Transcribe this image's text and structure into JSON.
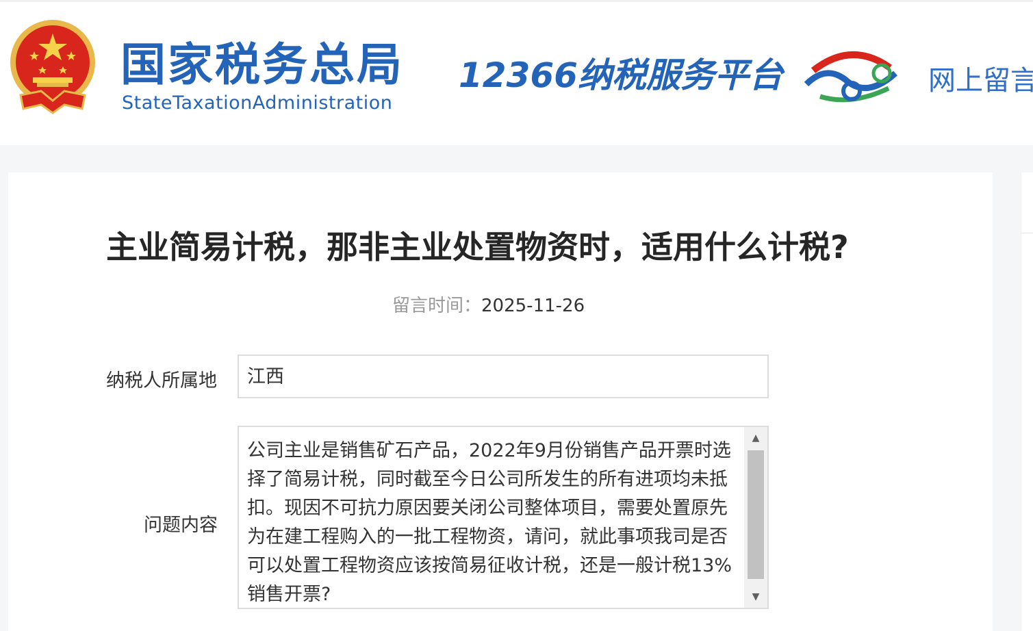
{
  "header": {
    "brand_cn": "国家税务总局",
    "brand_en": "StateTaxationAdministration",
    "platform_title": "12366纳税服务平台",
    "nav_link": "网上留言",
    "accent_color": "#2464b8"
  },
  "article": {
    "title": "主业简易计税，那非主业处置物资时，适用什么计税?",
    "meta_label": "留言时间：",
    "meta_date": "2025-11-26"
  },
  "form": {
    "region_label": "纳税人所属地",
    "region_value": "江西",
    "question_label": "问题内容",
    "question_value": "公司主业是销售矿石产品，2022年9月份销售产品开票时选择了简易计税，同时截至今日公司所发生的所有进项均未抵扣。现因不可抗力原因要关闭公司整体项目，需要处置原先为在建工程购入的一批工程物资，请问，就此事项我司是否可以处置工程物资应该按简易征收计税，还是一般计税13%销售开票?"
  },
  "icons": {
    "emblem": "national-emblem-icon",
    "hotline_logo": "12366-logo-icon",
    "scroll_up": "scroll-up-arrow-icon",
    "scroll_down": "scroll-down-arrow-icon"
  }
}
